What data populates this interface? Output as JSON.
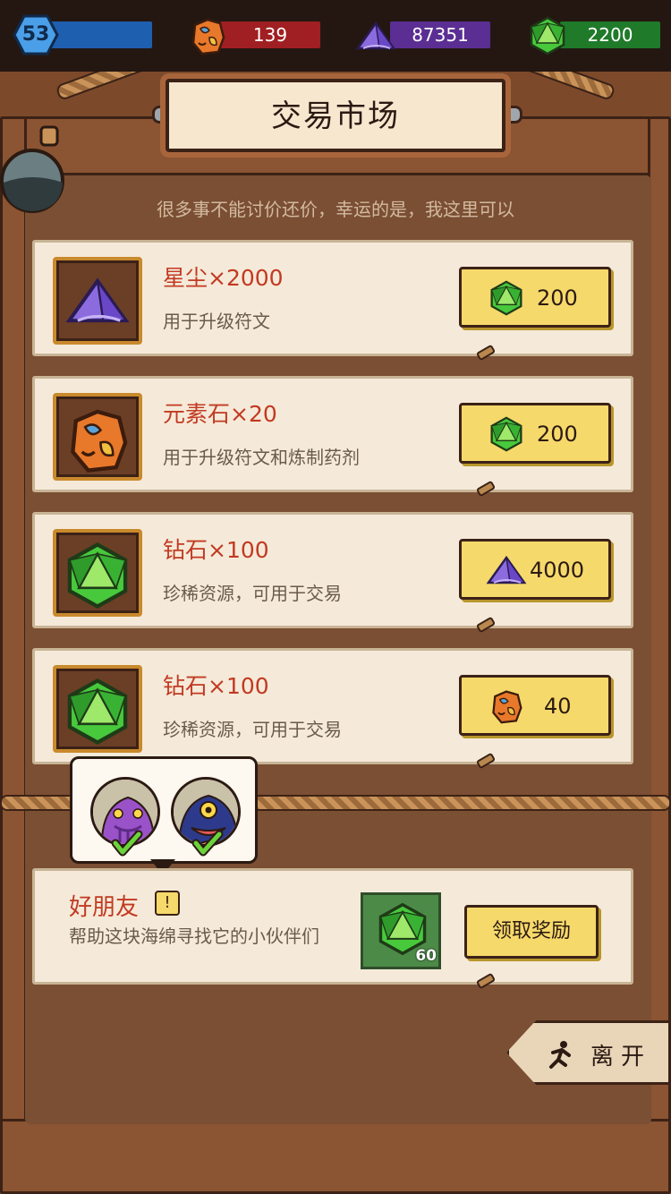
{
  "top_bar": {
    "level": "53",
    "element_stone": "139",
    "stardust": "87351",
    "diamonds": "2200",
    "colors": {
      "level": "#1f5fb0",
      "element": "#a01f22",
      "stardust": "#5b2e93",
      "diamond": "#1f7a2a"
    }
  },
  "title": "交易市场",
  "subtitle": "很多事不能讨价还价，幸运的是，我这里可以",
  "offers": [
    {
      "name": "星尘×2000",
      "desc": "用于升级符文",
      "item_icon": "stardust-icon",
      "price_icon": "diamond-icon",
      "price": "200"
    },
    {
      "name": "元素石×20",
      "desc": "用于升级符文和炼制药剂",
      "item_icon": "element-stone-icon",
      "price_icon": "diamond-icon",
      "price": "200"
    },
    {
      "name": "钻石×100",
      "desc": "珍稀资源，可用于交易",
      "item_icon": "diamond-icon",
      "price_icon": "stardust-icon",
      "price": "4000"
    },
    {
      "name": "钻石×100",
      "desc": "珍稀资源，可用于交易",
      "item_icon": "diamond-icon",
      "price_icon": "element-stone-icon",
      "price": "40"
    }
  ],
  "quest": {
    "title": "好朋友",
    "alert": "!",
    "desc": "帮助这块海绵寻找它的小伙伴们",
    "reward_icon": "diamond-icon",
    "reward_count": "60",
    "claim_label": "领取奖励"
  },
  "friends": [
    {
      "icon": "purple-squid-monster-icon",
      "status": "check-icon"
    },
    {
      "icon": "one-eyed-blue-monster-icon",
      "status": "check-icon"
    }
  ],
  "leave_label": "离开"
}
